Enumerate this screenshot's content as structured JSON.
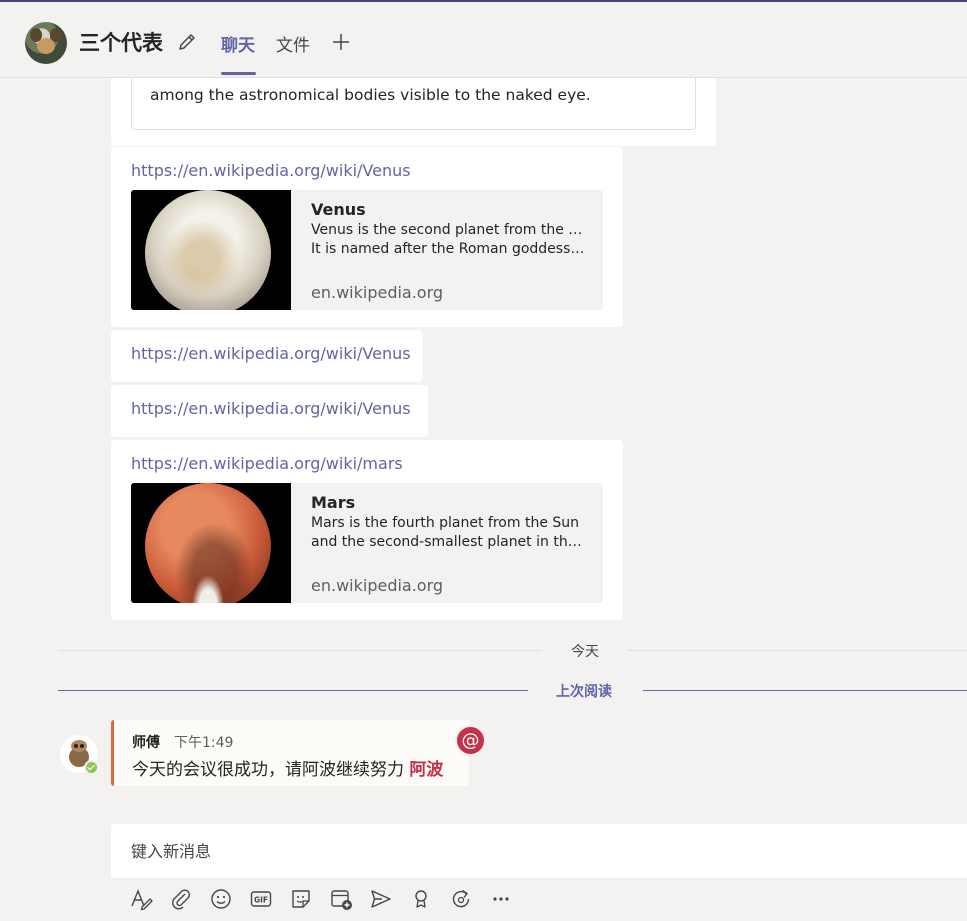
{
  "header": {
    "title": "三个代表",
    "tabs": [
      {
        "label": "聊天",
        "active": true
      },
      {
        "label": "文件",
        "active": false
      }
    ]
  },
  "messages": {
    "partial_card": {
      "description": "among the astronomical bodies visible to the naked eye."
    },
    "venus_card": {
      "url": "https://en.wikipedia.org/wiki/Venus",
      "preview_title": "Venus",
      "preview_line1": "Venus is the second planet from the Sun.",
      "preview_line2": "It is named after the Roman goddess o...",
      "preview_domain": "en.wikipedia.org"
    },
    "link_1": "https://en.wikipedia.org/wiki/Venus",
    "link_2": "https://en.wikipedia.org/wiki/Venus",
    "mars_card": {
      "url": "https://en.wikipedia.org/wiki/mars",
      "preview_title": "Mars",
      "preview_line1": "Mars is the fourth planet from the Sun",
      "preview_line2": "and the second-smallest planet in the...",
      "preview_domain": "en.wikipedia.org"
    }
  },
  "dividers": {
    "today": "今天",
    "last_read": "上次阅读"
  },
  "mention_message": {
    "sender": "师傅",
    "time": "下午1:49",
    "text": "今天的会议很成功，请阿波继续努力",
    "mention": "阿波",
    "badge": "@"
  },
  "compose": {
    "placeholder": "键入新消息"
  },
  "toolbar": {
    "icons": [
      "format-icon",
      "attach-icon",
      "emoji-icon",
      "gif-icon",
      "sticker-icon",
      "schedule-meeting-icon",
      "send-icon",
      "praise-icon",
      "loop-icon",
      "more-options-icon"
    ]
  },
  "colors": {
    "brand": "#6264a7",
    "mention": "#c4314b",
    "mention_border": "#d96c3c",
    "presence_available": "#92c353"
  }
}
